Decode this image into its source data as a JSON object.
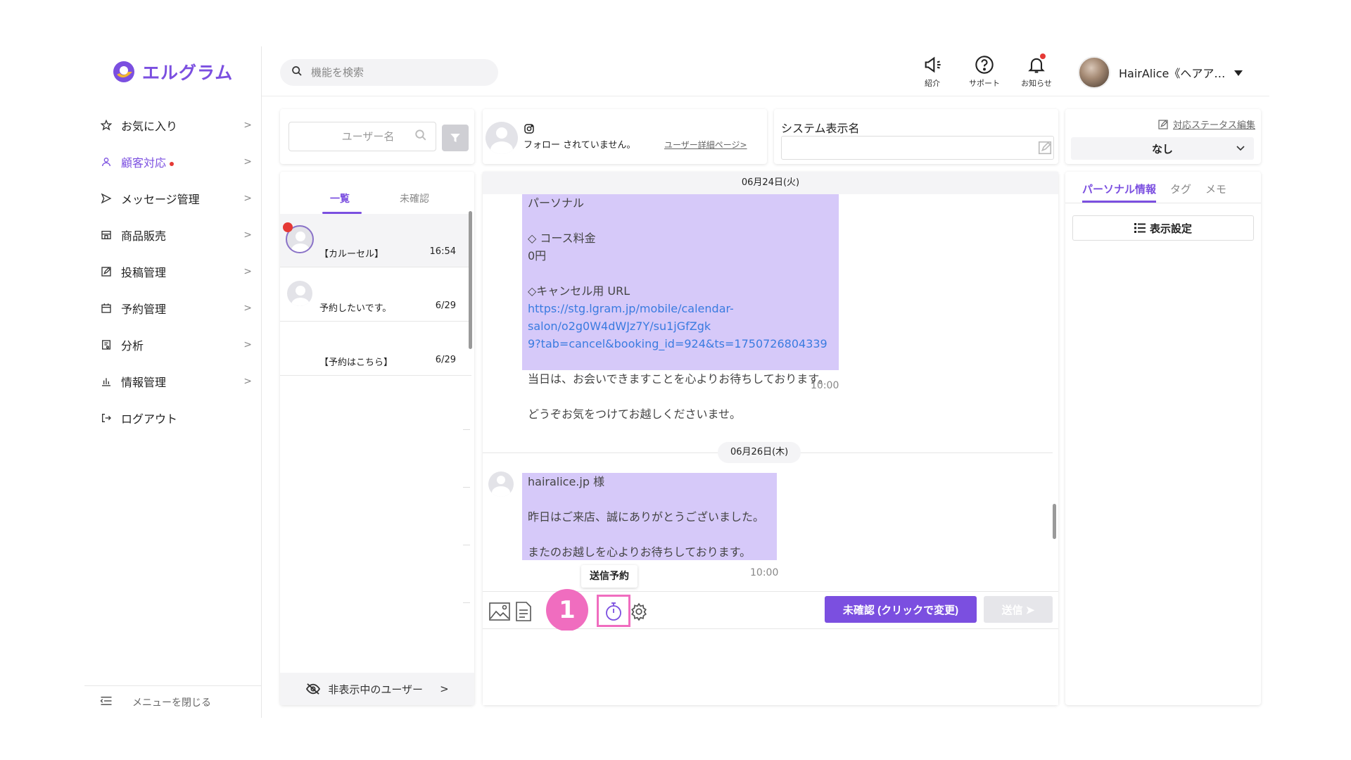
{
  "brand": {
    "name": "エルグラム",
    "accent": "#7b4fe0"
  },
  "sidebar": {
    "items": [
      {
        "label": "お気に入り",
        "icon": "star-icon"
      },
      {
        "label": "顧客対応",
        "icon": "person-icon",
        "active": true,
        "badge": "red-dot"
      },
      {
        "label": "メッセージ管理",
        "icon": "send-icon"
      },
      {
        "label": "商品販売",
        "icon": "shop-icon"
      },
      {
        "label": "投稿管理",
        "icon": "edit-icon"
      },
      {
        "label": "予約管理",
        "icon": "calendar-icon"
      },
      {
        "label": "分析",
        "icon": "report-icon"
      },
      {
        "label": "情報管理",
        "icon": "bar-chart-icon"
      },
      {
        "label": "ログアウト",
        "icon": "logout-icon"
      }
    ],
    "close_menu": "メニューを閉じる"
  },
  "header": {
    "search_placeholder": "機能を検索",
    "icons": [
      {
        "label": "紹介",
        "icon": "megaphone-icon"
      },
      {
        "label": "サポート",
        "icon": "help-icon"
      },
      {
        "label": "お知らせ",
        "icon": "bell-icon"
      }
    ],
    "user_name": "HairAlice《ヘアア…"
  },
  "user_list": {
    "search_placeholder": "ユーザー名",
    "tabs": [
      "一覧",
      "未確認"
    ],
    "rows": [
      {
        "message": "【カルーセル】",
        "time": "16:54"
      },
      {
        "message": "予約したいです。",
        "time": "6/29"
      },
      {
        "message": "【予約はこちら】",
        "time": "6/29"
      }
    ],
    "hidden_users": "非表示中のユーザー"
  },
  "chat_header": {
    "follow_status": "フォロー されていません。",
    "user_detail": "ユーザー詳細ページ>"
  },
  "system_name": {
    "label": "システム表示名",
    "value": ""
  },
  "chat": {
    "date1": "06月24日(火)",
    "bubble1": {
      "lines": [
        "パーソナル",
        "",
        "◇ コース料金",
        "0円",
        "",
        "◇キャンセル用 URL"
      ],
      "link": "https://stg.lgram.jp/mobile/calendar-salon/o2g0W4dWJz7Y/su1jGfZgk9?tab=cancel&booking_id=924&ts=1750726804339",
      "link_line1": "https://stg.lgram.jp/mobile/calendar-salon/o2g0W4dWJz7Y/su1jGfZgk",
      "link_line2": "9?tab=cancel&booking_id=924&ts=1750726804339",
      "after": [
        "",
        "当日は、お会いできますことを心よりお待ちしております。",
        "",
        "どうぞお気をつけてお越しくださいませ。"
      ],
      "time": "10:00"
    },
    "date2": "06月26日(木)",
    "bubble2": {
      "lines": [
        "hairalice.jp 様",
        "",
        "昨日はご来店、誠にありがとうございました。",
        "",
        "またのお越しを心よりお待ちしております。"
      ],
      "time": "10:00"
    },
    "toolbar": {
      "tooltip": "送信予約",
      "step": "1",
      "unconfirmed_btn": "未確認 (クリックで変更)",
      "send_btn": "送信"
    }
  },
  "status_panel": {
    "edit_link": "対応ステータス編集",
    "value": "なし"
  },
  "info_panel": {
    "tabs": [
      "パーソナル情報",
      "タグ",
      "メモ"
    ],
    "display_settings": "表示設定"
  }
}
